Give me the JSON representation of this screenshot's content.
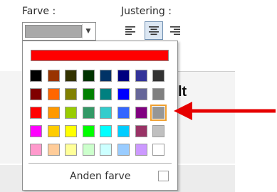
{
  "labels": {
    "color": "Farve :",
    "alignment": "Justering :"
  },
  "color_dropdown": {
    "selected_color": "#a9a9a9"
  },
  "alignment_buttons": [
    {
      "id": "align-left",
      "icon": "align-left-icon",
      "active": false
    },
    {
      "id": "align-center",
      "icon": "align-center-icon",
      "active": true
    },
    {
      "id": "align-right",
      "icon": "align-right-icon",
      "active": false
    }
  ],
  "background_text": "lt",
  "palette": {
    "top_color": "#ff0000",
    "rows": [
      [
        "#000000",
        "#993300",
        "#333300",
        "#003300",
        "#003366",
        "#000080",
        "#333399",
        "#333333"
      ],
      [
        "#800000",
        "#ff6600",
        "#808000",
        "#008000",
        "#008080",
        "#0000ff",
        "#666699",
        "#808080"
      ],
      [
        "#ff0000",
        "#ff9900",
        "#99cc00",
        "#339966",
        "#33cccc",
        "#3366ff",
        "#800080",
        "#969696"
      ],
      [
        "#ff00ff",
        "#ffcc00",
        "#ffff00",
        "#00ff00",
        "#00ffff",
        "#00ccff",
        "#993366",
        "#c0c0c0"
      ],
      [
        "#ff99cc",
        "#ffcc99",
        "#ffff99",
        "#ccffcc",
        "#ccffff",
        "#99ccff",
        "#cc99ff",
        "#ffffff"
      ]
    ],
    "selected": {
      "row": 2,
      "col": 7
    },
    "more_colors_label": "Anden farve"
  },
  "annotation": {
    "arrow_color": "#e60000"
  }
}
